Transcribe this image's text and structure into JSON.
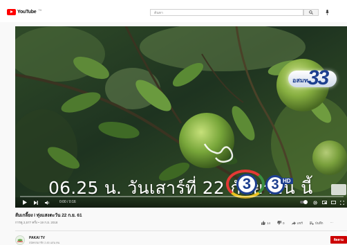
{
  "header": {
    "logo_text": "YouTube",
    "logo_region": "TH",
    "search_placeholder": "ค้นหา",
    "search_icon": "search-icon",
    "mic_icon": "mic-icon"
  },
  "player": {
    "caption": "06.25 น. วันเสาร์ที่ 22 กันยายน นี้",
    "channel_number": "3",
    "hd_label": "HD",
    "mcot_label": "อสมท",
    "mcot_number": "33",
    "time": "0:00 / 0:16",
    "progress": 0.0,
    "accent": "#ff0000"
  },
  "video": {
    "title": "ส้มเกลี้ยง l ทุ่งแสงตะวัน 22 ก.ย. 61",
    "meta": "การดู 2,577 ครั้ง • 19 ก.ย. 2018",
    "likes": "14",
    "dislikes": "0",
    "share_label": "แชร์",
    "save_label": "บันทึก"
  },
  "channel": {
    "name": "PAKAI TV",
    "subscribers": "สมัครสมาชิก 2.83 แสน คน",
    "subscribe_label": "ติดตาม",
    "subscribe_color": "#cc0000"
  }
}
